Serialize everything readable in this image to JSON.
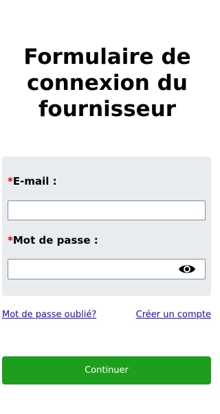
{
  "page": {
    "title": "Formulaire de connexion du fournisseur"
  },
  "form": {
    "required_mark": "*",
    "email": {
      "label": "E-mail :",
      "value": "",
      "placeholder": ""
    },
    "password": {
      "label": "Mot de passe :",
      "value": "",
      "placeholder": "",
      "toggle_icon": "eye-icon"
    }
  },
  "links": {
    "forgot_password": "Mot de passe oublié?",
    "create_account": "Créer un compte"
  },
  "actions": {
    "continue_label": "Continuer"
  },
  "colors": {
    "required": "#e00000",
    "panel_background": "#e9ecef",
    "link": "#1a0dab",
    "primary_button": "#1e9e1e"
  }
}
